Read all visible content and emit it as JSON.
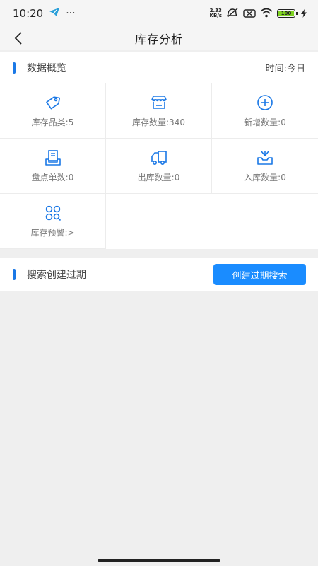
{
  "status_bar": {
    "time": "10:20",
    "dots": "···",
    "speed_value": "2.33",
    "speed_unit": "KB/s",
    "battery": "100"
  },
  "header": {
    "title": "库存分析"
  },
  "overview": {
    "title": "数据概览",
    "time_label": "时间:今日",
    "items": [
      {
        "label": "库存品类:5",
        "icon": "tag-icon"
      },
      {
        "label": "库存数量:340",
        "icon": "store-icon"
      },
      {
        "label": "新增数量:0",
        "icon": "plus-circle-icon"
      },
      {
        "label": "盘点单数:0",
        "icon": "document-tray-icon"
      },
      {
        "label": "出库数量:0",
        "icon": "truck-icon"
      },
      {
        "label": "入库数量:0",
        "icon": "inbox-icon"
      },
      {
        "label": "库存预警:>",
        "icon": "alert-grid-icon"
      }
    ]
  },
  "expiry_search": {
    "title": "搜索创建过期",
    "button_label": "创建过期搜索"
  },
  "colors": {
    "accent": "#1a78e6",
    "button": "#1a8cff",
    "icon": "#1a78e6"
  }
}
